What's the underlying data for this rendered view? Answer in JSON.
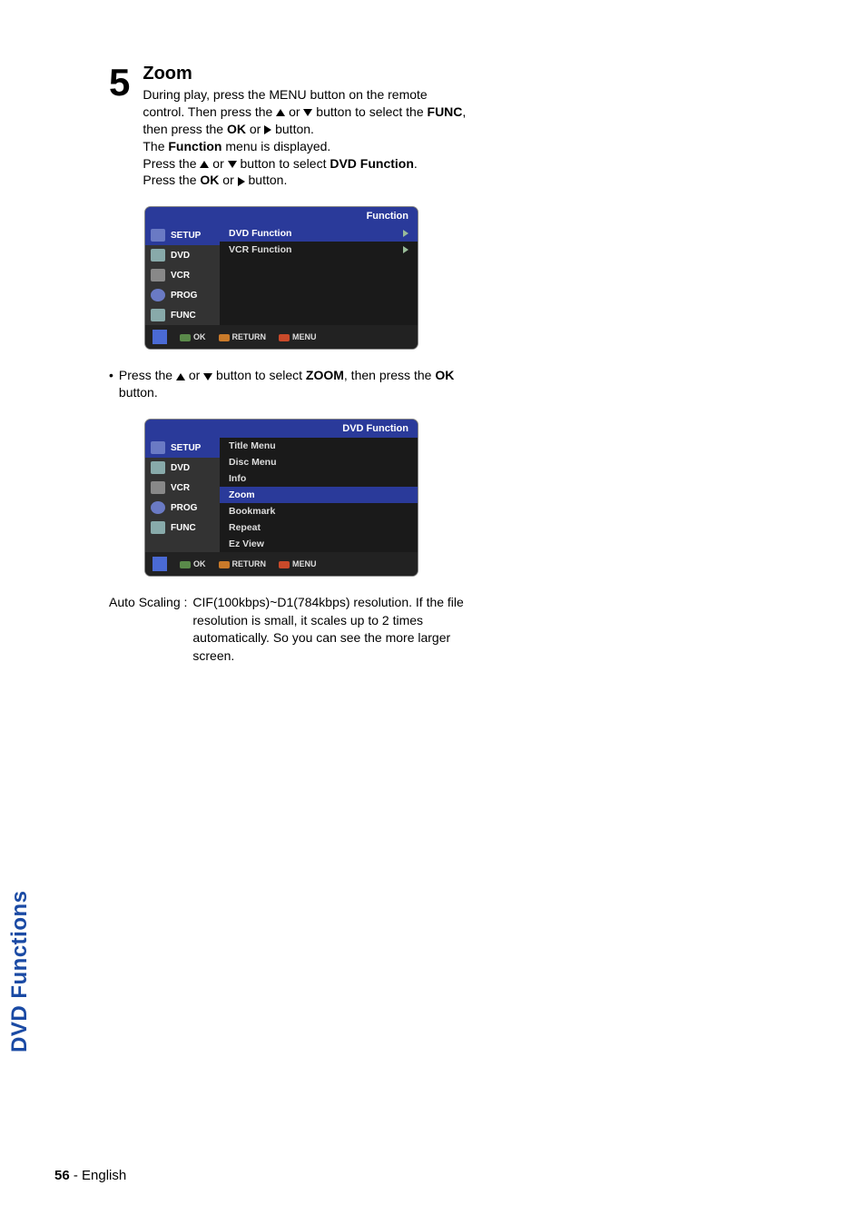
{
  "step": {
    "number": "5",
    "title": "Zoom",
    "p1a": "During play, press the MENU button on the remote control. Then press the ",
    "p1b": " or ",
    "p1c": " button to select the ",
    "func_word": "FUNC",
    "p1d": ", then press the ",
    "ok_word": "OK",
    "p1e": " or ",
    "p1f": " button.",
    "p2a": "The ",
    "function_word": "Function",
    "p2b": " menu is displayed.",
    "p3a": "Press the ",
    "p3b": " or ",
    "p3c": " button to select ",
    "dvd_func_word": "DVD Function",
    "p3d": ".",
    "p4a": "Press the ",
    "p4b": " or ",
    "p4c": " button."
  },
  "osd1": {
    "title": "Function",
    "side": [
      "SETUP",
      "DVD",
      "VCR",
      "PROG",
      "FUNC"
    ],
    "rows": [
      "DVD Function",
      "VCR Function"
    ],
    "footer": {
      "ok": "OK",
      "return": "RETURN",
      "menu": "MENU"
    }
  },
  "bullet": {
    "dot": "•",
    "a": "Press the ",
    "b": " or ",
    "c": " button to select ",
    "zoom_word": "ZOOM",
    "d": ", then press the ",
    "ok_word": "OK",
    "e": " button."
  },
  "osd2": {
    "title": "DVD Function",
    "side": [
      "SETUP",
      "DVD",
      "VCR",
      "PROG",
      "FUNC"
    ],
    "rows": [
      "Title Menu",
      "Disc Menu",
      "Info",
      "Zoom",
      "Bookmark",
      "Repeat",
      "Ez View"
    ],
    "footer": {
      "ok": "OK",
      "return": "RETURN",
      "menu": "MENU"
    }
  },
  "auto": {
    "label": "Auto Scaling :",
    "body": "CIF(100kbps)~D1(784kbps) resolution. If the file resolution is small, it scales up to 2 times automatically. So you can see the more larger screen."
  },
  "side_tab": "DVD Functions",
  "footer": {
    "page": "56",
    "dash": "-",
    "lang": "English"
  }
}
